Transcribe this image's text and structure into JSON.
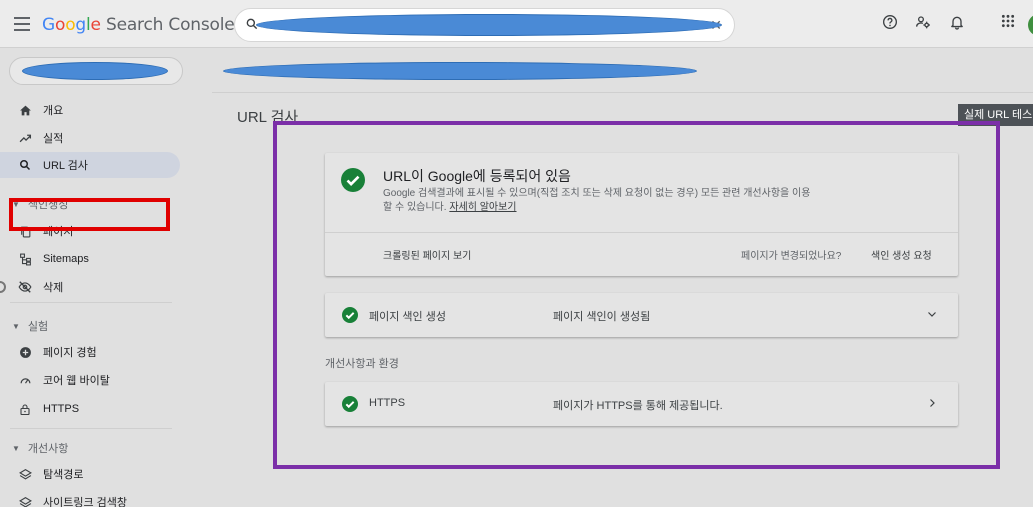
{
  "app": {
    "name_google": "Google",
    "name_rest": " Search Console"
  },
  "search": {
    "value": "",
    "placeholder": ""
  },
  "topbar_icons": [
    "help-icon",
    "manage-users-icon",
    "bell-icon",
    "apps-grid-icon"
  ],
  "sidebar": {
    "overview": "개요",
    "performance": "실적",
    "url_inspection": "URL 검사",
    "indexing_section": "색인생성",
    "pages": "페이지",
    "sitemaps": "Sitemaps",
    "removals": "삭제",
    "experience_section": "실험",
    "page_experience": "페이지 경험",
    "core_web_vitals": "코어 웹 바이탈",
    "https": "HTTPS",
    "enhancements_section": "개선사항",
    "breadcrumbs": "탐색경로",
    "sitelinks_searchbox": "사이트링크 검색창"
  },
  "page": {
    "title": "URL 검사",
    "live_test_button": "실제 URL 테스"
  },
  "status_card": {
    "headline": "URL이 Google에 등록되어 있음",
    "description": "Google 검색결과에 표시될 수 있으며(직접 조치 또는 삭제 요청이 없는 경우) 모든 관련 개선사항을 이용할 수 있습니다.",
    "learn_more": "자세히 알아보기",
    "view_crawled": "크롤링된 페이지 보기",
    "page_changed": "페이지가 변경되었나요?",
    "request_indexing": "색인 생성 요청"
  },
  "indexing_row": {
    "name": "페이지 색인 생성",
    "value": "페이지 색인이 생성됨"
  },
  "enhancements_header": "개선사항과 환경",
  "https_row": {
    "name": "HTTPS",
    "value": "페이지가 HTTPS를 통해 제공됩니다."
  },
  "colors": {
    "success_green": "#188038",
    "highlight_red": "#e00000",
    "highlight_purple": "#7b2fa8"
  }
}
